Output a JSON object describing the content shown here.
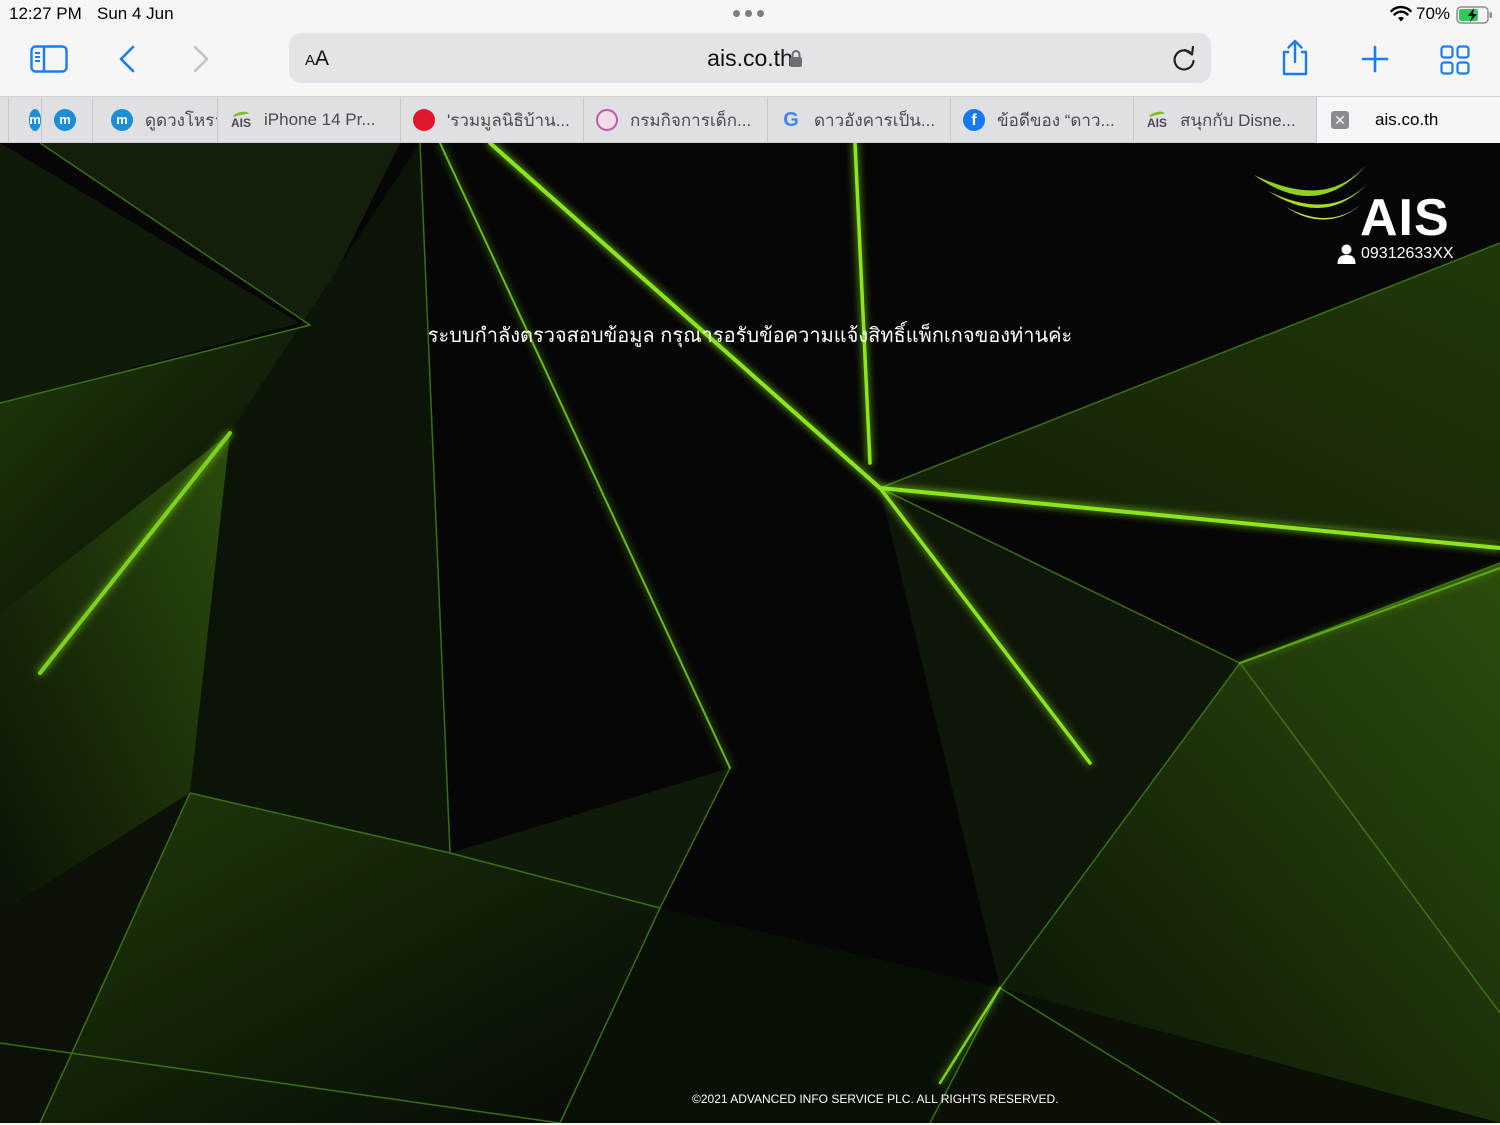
{
  "status_bar": {
    "time": "12:27 PM",
    "date": "Sun 4 Jun",
    "battery_percent": "70%",
    "battery_level": 0.7,
    "charging": true
  },
  "toolbar": {
    "text_size_label": "AA",
    "url": "ais.co.th",
    "icons": [
      "sidebar-icon",
      "back-chevron-icon",
      "forward-chevron-icon",
      "lock-icon",
      "reload-icon",
      "share-icon",
      "plus-icon",
      "tab-grid-icon"
    ]
  },
  "tabs": [
    {
      "title": "",
      "favicon": "m-icon"
    },
    {
      "title": "ดูดวงโหรา",
      "favicon": "m-icon"
    },
    {
      "title": "iPhone 14 Pr...",
      "favicon": "ais-icon"
    },
    {
      "title": "'รวมมูลนิธิบ้าน...",
      "favicon": "red-circle-icon"
    },
    {
      "title": "กรมกิจการเด็ก...",
      "favicon": "seal-icon"
    },
    {
      "title": "ดาวอังคารเป็น...",
      "favicon": "google-icon"
    },
    {
      "title": "ข้อดีของ “ดาว...",
      "favicon": "facebook-icon"
    },
    {
      "title": "สนุกกับ Disne...",
      "favicon": "ais-icon"
    },
    {
      "title": "ais.co.th",
      "favicon": "close-icon",
      "active": true
    }
  ],
  "page": {
    "brand": "AIS",
    "phone_number": "09312633XX",
    "message": "ระบบกำลังตรวจสอบข้อมูล กรุณารอรับข้อความแจ้งสิทธิ์แพ็กเกจของท่านค่ะ",
    "footer": "©2021 ADVANCED INFO SERVICE PLC. ALL RIGHTS RESERVED.",
    "colors": {
      "accent_green": "#7fd11b",
      "background": "#050605"
    }
  }
}
